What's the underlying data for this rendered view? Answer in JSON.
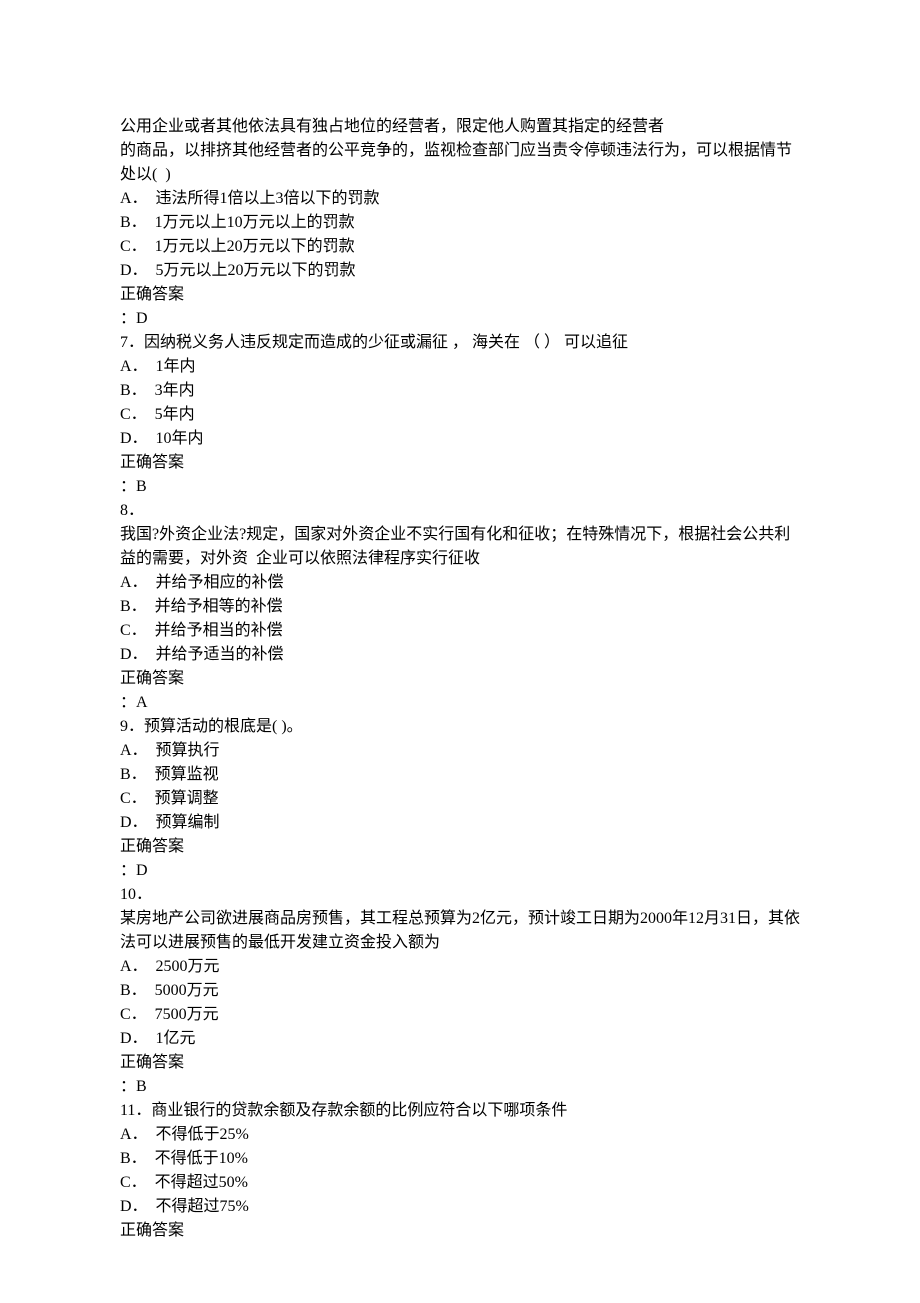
{
  "q6": {
    "stem1": "公用企业或者其他依法具有独占地位的经营者，限定他人购置其指定的经营者",
    "stem2": "的商品，以排挤其他经营者的公平竞争的，监视检查部门应当责令停顿违法行为，可以根据情节处以(  )",
    "optA": "A．  违法所得1倍以上3倍以下的罚款",
    "optB": "B．  1万元以上10万元以上的罚款",
    "optC": "C．  1万元以上20万元以下的罚款",
    "optD": "D．  5万元以上20万元以下的罚款",
    "ansLabel": "正确答案",
    "ans": "：D"
  },
  "q7": {
    "stem": "7．因纳税义务人违反规定而造成的少征或漏征 ， 海关在 （ ） 可以追征",
    "optA": "A．  1年内",
    "optB": "B．  3年内",
    "optC": "C．  5年内",
    "optD": "D．  10年内",
    "ansLabel": "正确答案",
    "ans": "：B"
  },
  "q8": {
    "num": "8．",
    "stem": "我国?外资企业法?规定，国家对外资企业不实行国有化和征收；在特殊情况下，根据社会公共利益的需要，对外资  企业可以依照法律程序实行征收",
    "optA": "A．  并给予相应的补偿",
    "optB": "B．  并给予相等的补偿",
    "optC": "C．  并给予相当的补偿",
    "optD": "D．  并给予适当的补偿",
    "ansLabel": "正确答案",
    "ans": "：A"
  },
  "q9": {
    "stem": "9．预算活动的根底是( )。",
    "optA": "A．  预算执行",
    "optB": "B．  预算监视",
    "optC": "C．  预算调整",
    "optD": "D．  预算编制",
    "ansLabel": "正确答案",
    "ans": "：D"
  },
  "q10": {
    "num": "10．",
    "stem": "某房地产公司欲进展商品房预售，其工程总预算为2亿元，预计竣工日期为2000年12月31日，其依法可以进展预售的最低开发建立资金投入额为",
    "optA": "A．  2500万元",
    "optB": "B．  5000万元",
    "optC": "C．  7500万元",
    "optD": "D．  1亿元",
    "ansLabel": "正确答案",
    "ans": "：B"
  },
  "q11": {
    "stem": "11．商业银行的贷款余额及存款余额的比例应符合以下哪项条件",
    "optA": "A．  不得低于25%",
    "optB": "B．  不得低于10%",
    "optC": "C．  不得超过50%",
    "optD": "D．  不得超过75%",
    "ansLabel": "正确答案"
  }
}
